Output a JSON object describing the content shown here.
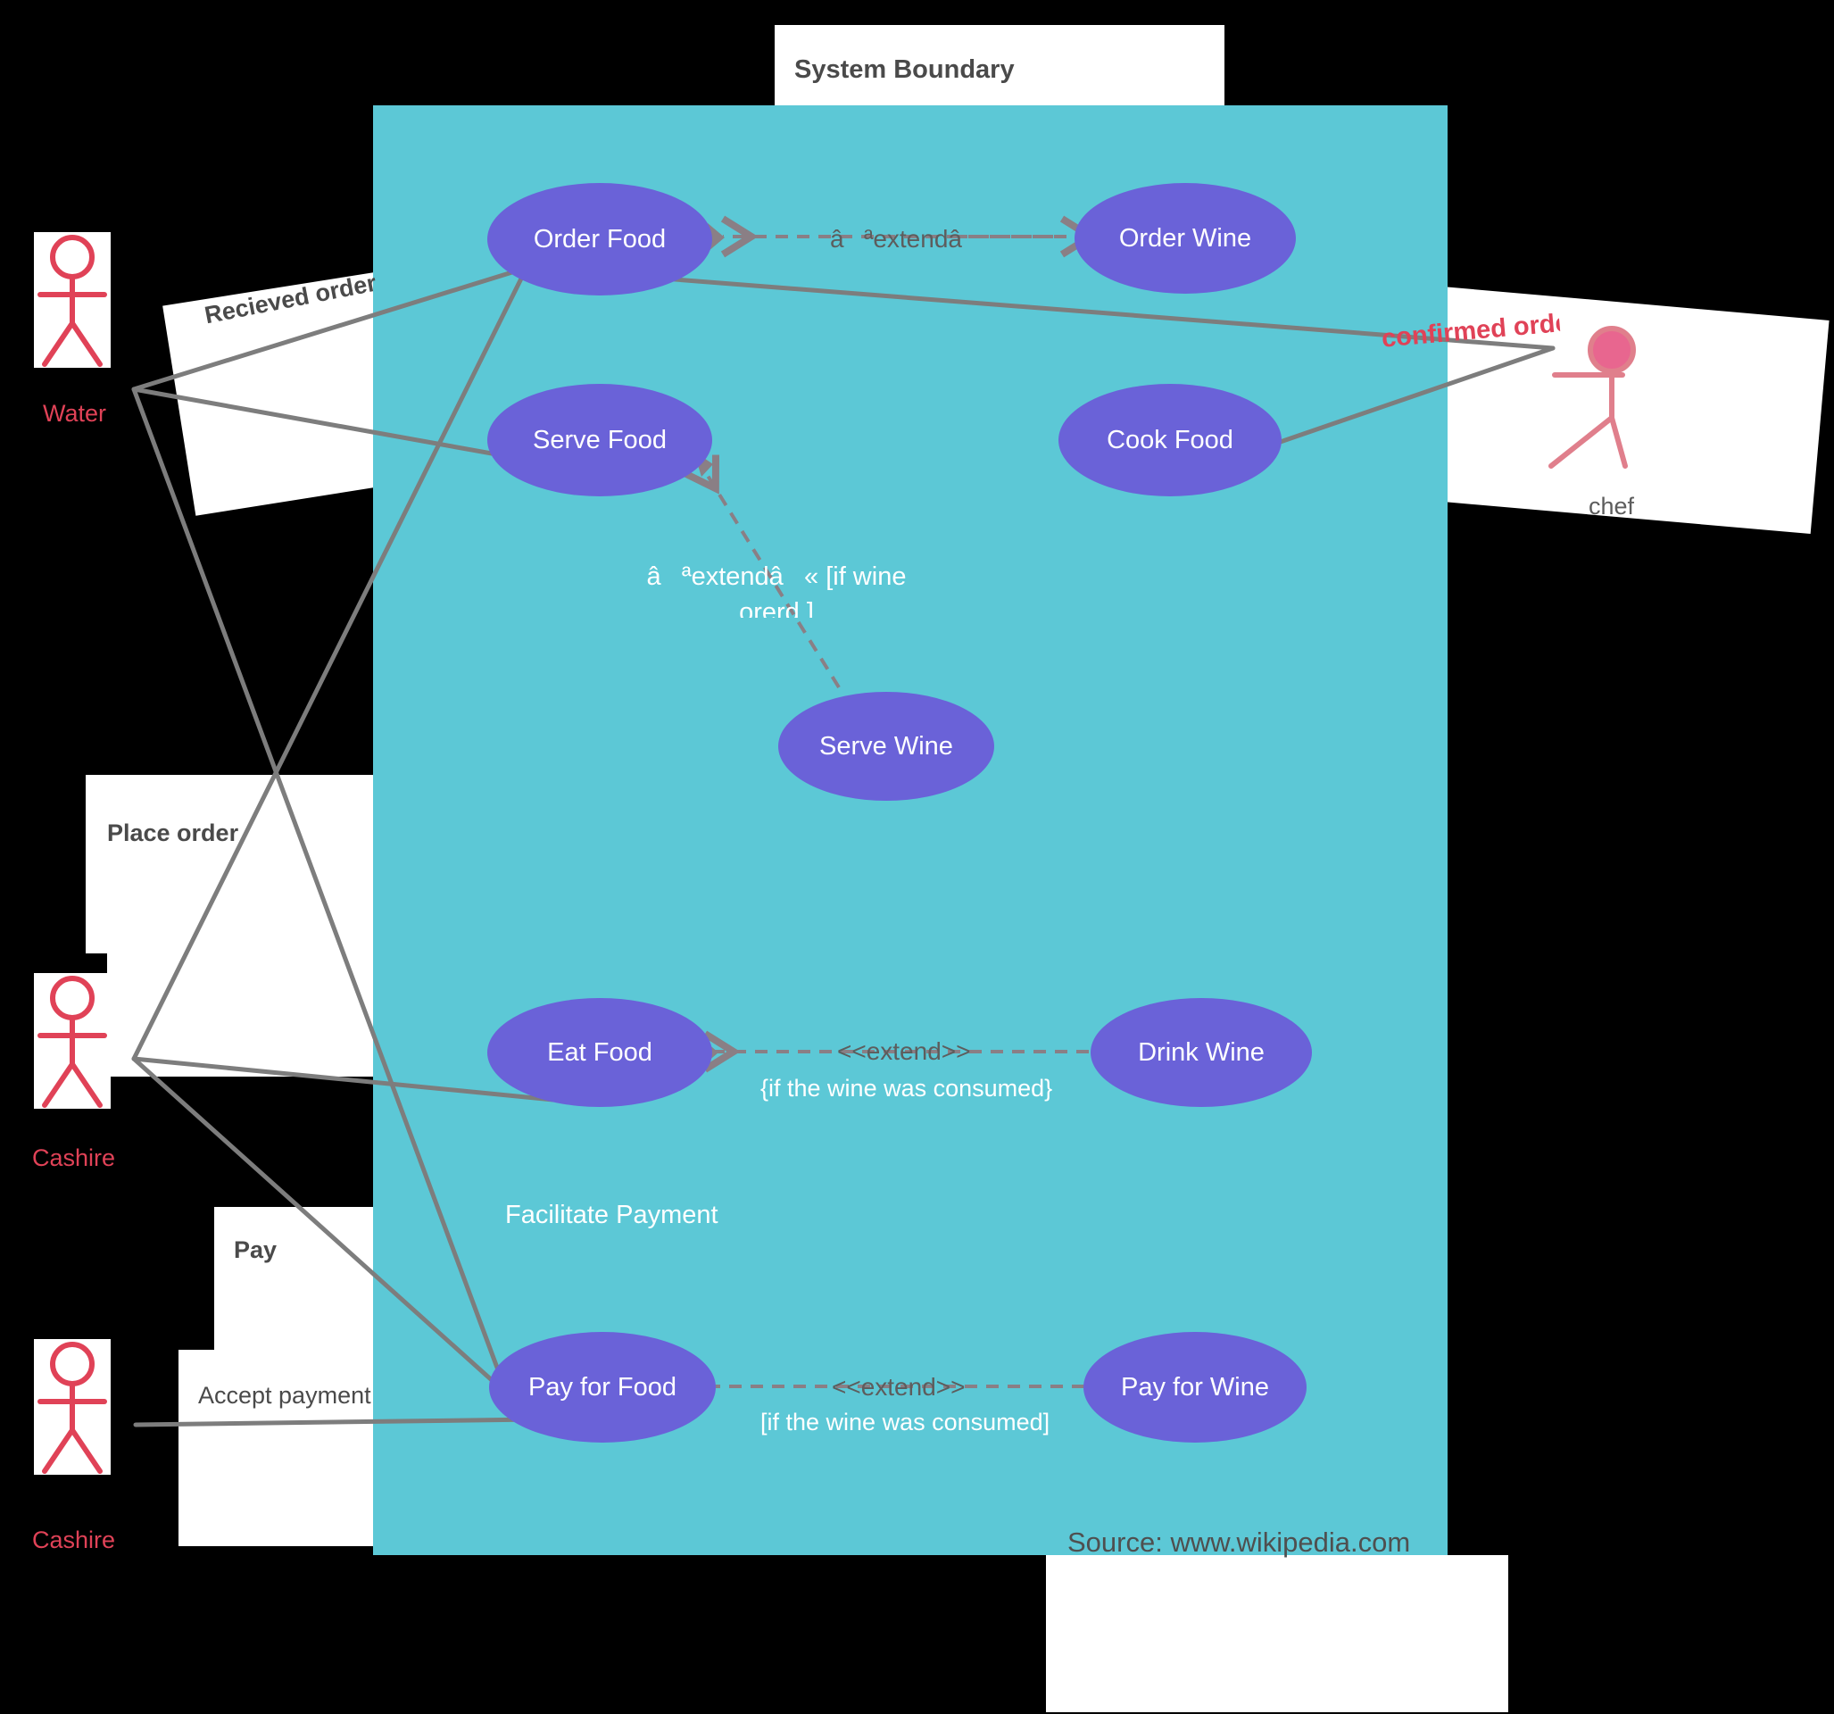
{
  "diagram": {
    "title": "System Boundary",
    "source": "Source: www.wikipedia.com",
    "facilitate_payment": "Facilitate Payment",
    "colors": {
      "boundary_fill": "#5cc8d6",
      "usecase_fill": "#6a62d8",
      "actor_red": "#e04257",
      "actor_pink": "#e8668f",
      "connector": "#7d7d7d",
      "background": "#000000",
      "card": "#ffffff"
    }
  },
  "usecases": [
    {
      "id": "order-food",
      "label": "Order Food"
    },
    {
      "id": "order-wine",
      "label": "Order Wine"
    },
    {
      "id": "serve-food",
      "label": "Serve Food"
    },
    {
      "id": "cook-food",
      "label": "Cook Food"
    },
    {
      "id": "serve-wine",
      "label": "Serve Wine"
    },
    {
      "id": "eat-food",
      "label": "Eat Food"
    },
    {
      "id": "drink-wine",
      "label": "Drink Wine"
    },
    {
      "id": "pay-for-food",
      "label": "Pay for Food"
    },
    {
      "id": "pay-for-wine",
      "label": "Pay for Wine"
    }
  ],
  "relationships": [
    {
      "id": "order-food-order-wine",
      "stereotype": "âªextendâ",
      "condition": ""
    },
    {
      "id": "serve-food-serve-wine",
      "stereotype": "âªextendâ« [if wine was",
      "condition": "orerd ]"
    },
    {
      "id": "eat-food-drink-wine",
      "stereotype": "<<extend>>",
      "condition": "{if the wine was consumed}"
    },
    {
      "id": "pay-food-pay-wine",
      "stereotype": "<<extend>>",
      "condition": "[if the wine was consumed]"
    }
  ],
  "actors": [
    {
      "id": "water",
      "label": "Water",
      "style": "outline-red"
    },
    {
      "id": "cashire-1",
      "label": "Cashire",
      "style": "outline-red"
    },
    {
      "id": "cashire-2",
      "label": "Cashire",
      "style": "outline-red"
    },
    {
      "id": "chef",
      "label": "chef",
      "style": "filled-pink"
    }
  ],
  "association_labels": [
    {
      "id": "recieved-order",
      "text": "Recieved order"
    },
    {
      "id": "place-order",
      "text": "Place order"
    },
    {
      "id": "pay",
      "text": "Pay"
    },
    {
      "id": "accept-payment",
      "text": "Accept payment"
    },
    {
      "id": "confirmed-order",
      "text": "confirmed order"
    }
  ]
}
